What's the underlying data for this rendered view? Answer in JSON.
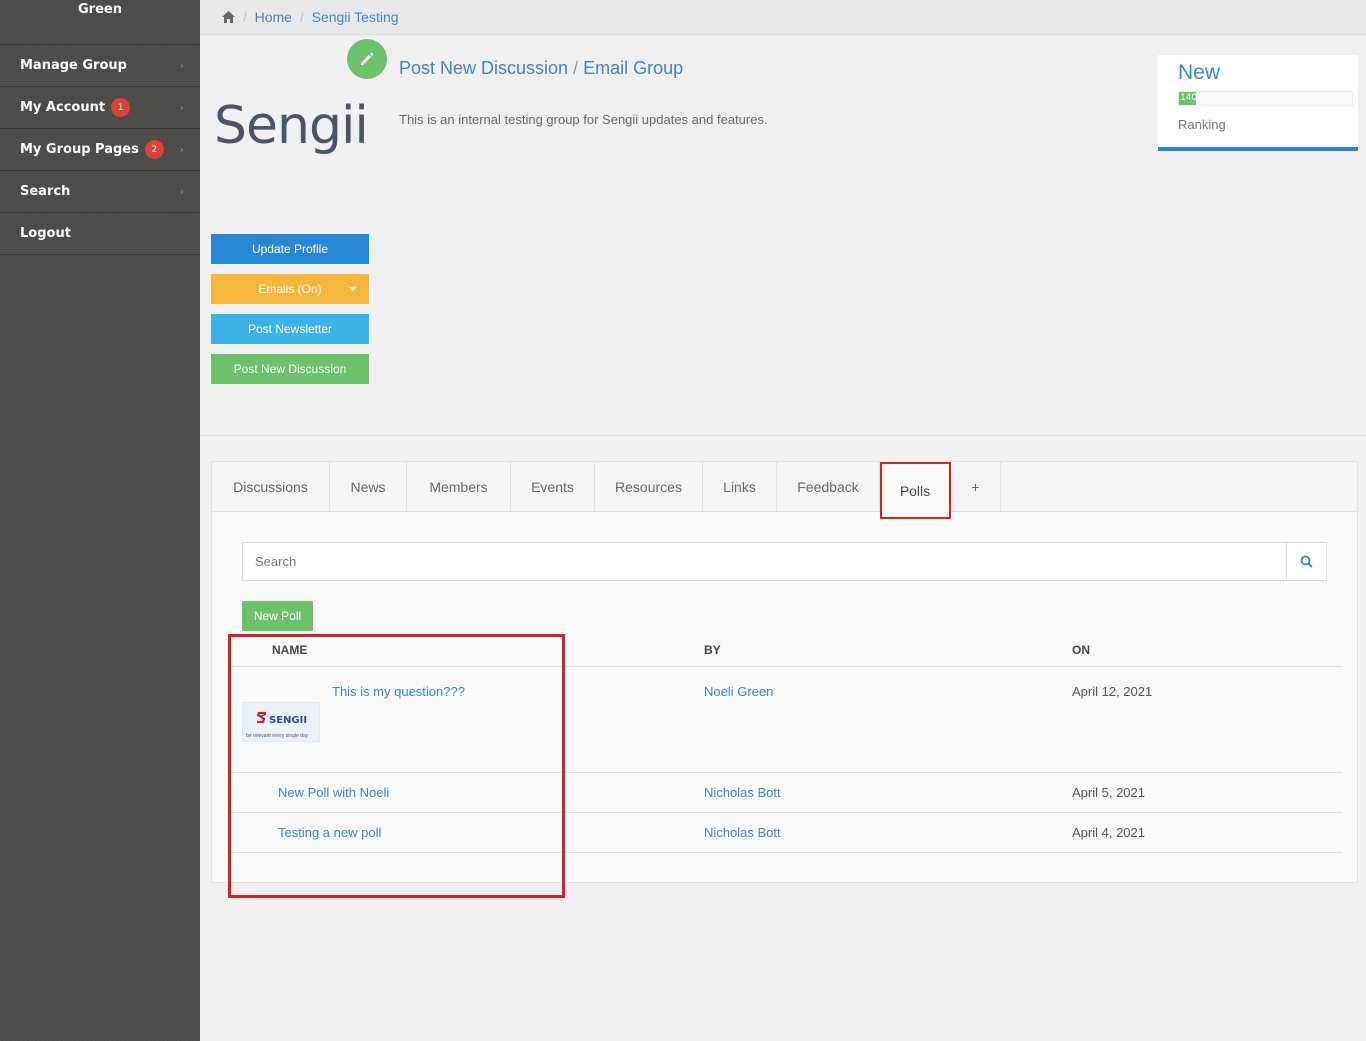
{
  "sidebar": {
    "user_name": "Green",
    "items": [
      {
        "label": "Manage Group",
        "badge": ""
      },
      {
        "label": "My Account",
        "badge": "1"
      },
      {
        "label": "My Group Pages",
        "badge": "2"
      },
      {
        "label": "Search",
        "badge": ""
      },
      {
        "label": "Logout",
        "badge": ""
      }
    ]
  },
  "breadcrumb": {
    "home": "Home",
    "current": "Sengii Testing"
  },
  "header": {
    "title_part1": "Post New Discussion",
    "title_sep": " / ",
    "title_part2": "Email Group",
    "description": "This is an internal testing group for Sengii updates and features.",
    "logo_text": "Sengii"
  },
  "actions": {
    "update_profile": "Update Profile",
    "emails": "Emails (On)",
    "post_newsletter": "Post Newsletter",
    "post_discussion": "Post New Discussion"
  },
  "ranking": {
    "status": "New",
    "score": "140",
    "score_fraction": 0.1,
    "label": "Ranking"
  },
  "tabs": [
    "Discussions",
    "News",
    "Members",
    "Events",
    "Resources",
    "Links",
    "Feedback",
    "Polls",
    "+"
  ],
  "active_tab": "Polls",
  "search": {
    "placeholder": "Search"
  },
  "new_poll_label": "New Poll",
  "table": {
    "headers": [
      "NAME",
      "BY",
      "ON"
    ],
    "rows": [
      {
        "name": "This is my question???",
        "by": "Noeli Green",
        "on": "April 12, 2021",
        "thumb_title": "SENGII",
        "thumb_sub": "be relevant every single day"
      },
      {
        "name": "New Poll with Noeli",
        "by": "Nicholas Bott",
        "on": "April 5, 2021"
      },
      {
        "name": "Testing a new poll",
        "by": "Nicholas Bott",
        "on": "April 4, 2021"
      }
    ]
  },
  "colors": {
    "sidebar_bg": "#4b4a47",
    "link": "#3a87c8",
    "green": "#6cc16b",
    "blue": "#2787d4",
    "orange": "#f5b83d",
    "lightblue": "#3cb3e6",
    "highlight": "#d3202a"
  }
}
